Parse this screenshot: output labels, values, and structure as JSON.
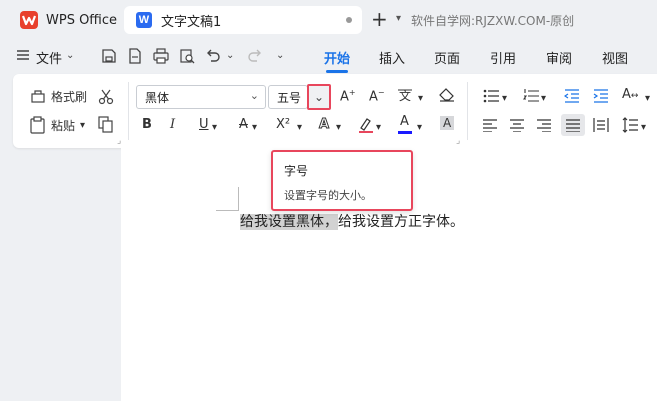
{
  "titlebar": {
    "app_name": "WPS Office",
    "doc_tab_badge": "W",
    "doc_tab_title": "文字文稿1",
    "new_tab_symbol": "+",
    "watermark": "软件自学网:RJZXW.COM-原创"
  },
  "menubar": {
    "file_label": "文件",
    "tabs": [
      "开始",
      "插入",
      "页面",
      "引用",
      "审阅",
      "视图"
    ],
    "active_tab": "开始"
  },
  "ribbon": {
    "format_painter": "格式刷",
    "paste": "粘贴",
    "font_name": "黑体",
    "font_size": "五号",
    "bold": "B",
    "italic": "I",
    "underline": "U",
    "strike": "A",
    "superscript": "X²",
    "font_effect": "A",
    "font_color": "A",
    "char_shading": "A",
    "font_color_hex": "#1a1aff",
    "accent_hex": "#1a73e8",
    "highlight_box_hex": "#e8465c"
  },
  "document": {
    "selected_text": "给我设置黑体，",
    "rest_text": "给我设置方正字体。"
  },
  "tooltip": {
    "title": "字号",
    "description": "设置字号的大小。"
  }
}
